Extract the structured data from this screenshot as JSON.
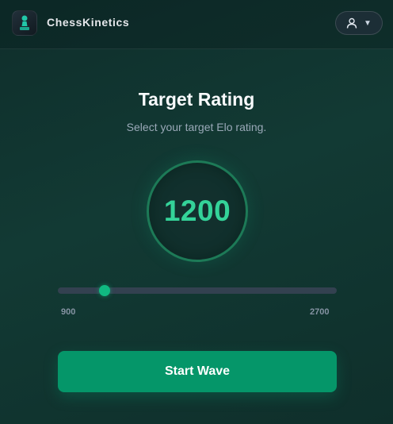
{
  "header": {
    "app_name": "ChessKinetics",
    "logo_icon": "chess-pawn-icon",
    "user_icon": "user-icon",
    "caret_icon": "chevron-down-icon",
    "caret": "▼"
  },
  "main": {
    "title": "Target Rating",
    "subtitle": "Select your target Elo rating.",
    "rating_value": "1200",
    "slider": {
      "min": 900,
      "max": 2700,
      "value": 1200,
      "min_label": "900",
      "max_label": "2700"
    },
    "start_label": "Start Wave"
  },
  "colors": {
    "accent": "#10b981",
    "accent_text": "#34d399",
    "button": "#059669",
    "background": "#123a34"
  }
}
